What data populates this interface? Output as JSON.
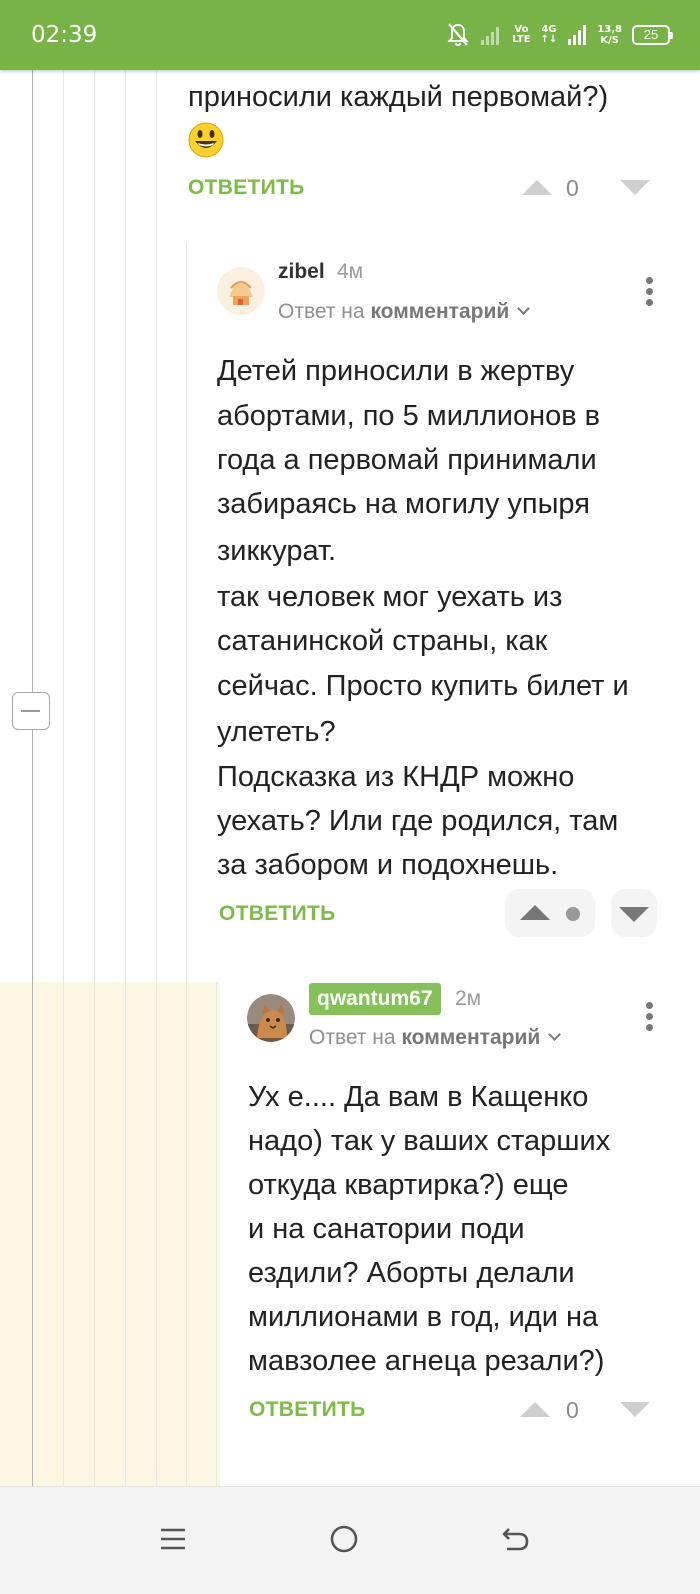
{
  "status_bar": {
    "time": "02:39",
    "network_type_top": "Vo",
    "network_type_bottom": "LTE",
    "lte_top": "4G",
    "lte_bottom": "↑↓",
    "speed_value": "13,8",
    "speed_unit": "K/S",
    "battery": "25",
    "icons": [
      "mute-bell-icon",
      "signal-weak-icon",
      "signal-strong-icon",
      "battery-icon"
    ]
  },
  "comments": [
    {
      "id": "parent-tail",
      "text_lines": [
        "приносили каждый первомай?)"
      ],
      "emoji": "😃",
      "reply_label": "ОТВЕТИТЬ",
      "votes": "0"
    },
    {
      "id": "zibel",
      "author": "zibel",
      "time": "4м",
      "reply_prefix": "Ответ на",
      "reply_target": "комментарий",
      "text_lines": [
        "Детей приносили в жертву",
        "абортами, по 5 миллионов в",
        "года а первомай принимали",
        "забираясь на могилу упыря",
        "зиккурат.",
        "так человек мог уехать из",
        "сатанинской страны, как",
        "сейчас. Просто купить билет и",
        "улететь?",
        "Подсказка из КНДР можно",
        "уехать? Или где родился, там",
        "за забором и подохнешь."
      ],
      "reply_label": "ОТВЕТИТЬ"
    },
    {
      "id": "qwantum67",
      "author": "qwantum67",
      "time": "2м",
      "reply_prefix": "Ответ на",
      "reply_target": "комментарий",
      "text_lines": [
        "Ух е.... Да вам в Кащенко",
        "надо) так у ваших старших",
        "откуда квартирка?) еще",
        "и на санатории поди",
        "ездили? Аборты делали",
        "миллионами в год, иди на",
        "мавзолее агнеца резали?)"
      ],
      "reply_label": "ОТВЕТИТЬ",
      "votes": "0"
    }
  ],
  "nav_bar": {
    "icons": [
      "menu-icon",
      "home-icon",
      "back-icon"
    ]
  },
  "colors": {
    "accent": "#77b346",
    "reply_link": "#7dba4a",
    "highlight": "#fdf6e3"
  }
}
